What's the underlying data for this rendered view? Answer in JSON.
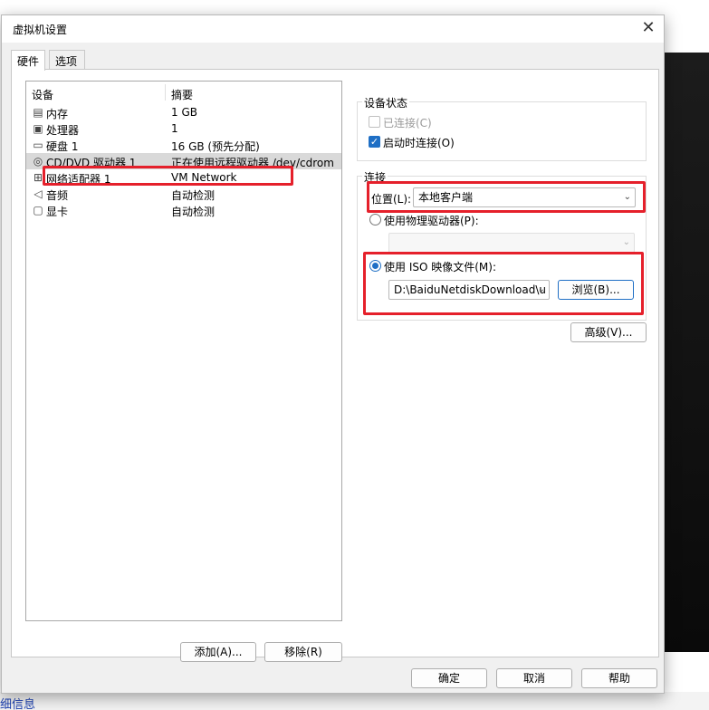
{
  "background": {
    "bottom_text": "细信息"
  },
  "dialog": {
    "title": "虚拟机设置",
    "close_glyph": "✕"
  },
  "tabs": [
    {
      "label": "硬件"
    },
    {
      "label": "选项"
    }
  ],
  "device_list": {
    "headers": {
      "device": "设备",
      "summary": "摘要"
    },
    "rows": [
      {
        "icon": "memory-icon",
        "glyph": "▤",
        "name": "内存",
        "summary": "1 GB"
      },
      {
        "icon": "processor-icon",
        "glyph": "▣",
        "name": "处理器",
        "summary": "1"
      },
      {
        "icon": "hard-disk-icon",
        "glyph": "▭",
        "name": "硬盘 1",
        "summary": "16 GB (预先分配)"
      },
      {
        "icon": "cd-dvd-icon",
        "glyph": "◎",
        "name": "CD/DVD 驱动器 1",
        "summary": "正在使用远程驱动器 /dev/cdrom"
      },
      {
        "icon": "network-adapter-icon",
        "glyph": "⊞",
        "name": "网络适配器 1",
        "summary": "VM Network"
      },
      {
        "icon": "audio-icon",
        "glyph": "◁",
        "name": "音频",
        "summary": "自动检测"
      },
      {
        "icon": "display-icon",
        "glyph": "▢",
        "name": "显卡",
        "summary": "自动检测"
      }
    ],
    "selected_index": 3
  },
  "list_buttons": {
    "add": "添加(A)...",
    "remove": "移除(R)"
  },
  "device_status": {
    "title": "设备状态",
    "connected_label": "已连接(C)",
    "connected_checked": false,
    "connect_on_start_label": "启动时连接(O)",
    "connect_on_start_checked": true,
    "check_glyph": "✓"
  },
  "connection": {
    "title": "连接",
    "location_label": "位置(L):",
    "location_value": "本地客户端",
    "physical_drive_label": "使用物理驱动器(P):",
    "physical_drive_value": "",
    "iso_label": "使用 ISO 映像文件(M):",
    "iso_value": "D:\\BaiduNetdiskDownload\\u",
    "browse_label": "浏览(B)...",
    "selected_option": "iso",
    "chevron_glyph": "⌄"
  },
  "advanced_label": "高级(V)...",
  "footer": {
    "ok": "确定",
    "cancel": "取消",
    "help": "帮助"
  },
  "colors": {
    "highlight_red": "#e5202b",
    "accent_blue": "#1f6fc5"
  }
}
